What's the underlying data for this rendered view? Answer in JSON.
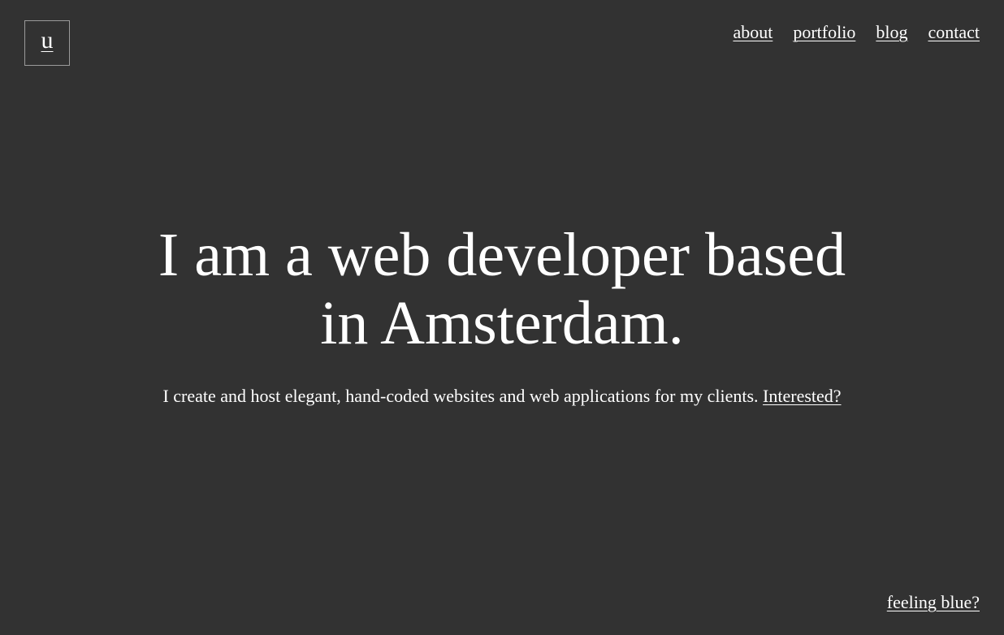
{
  "logo": {
    "letter": "u"
  },
  "nav": {
    "items": [
      {
        "label": "about"
      },
      {
        "label": "portfolio"
      },
      {
        "label": "blog"
      },
      {
        "label": "contact"
      }
    ]
  },
  "hero": {
    "heading_line1": "I am a web developer based",
    "heading_line2": "in Amsterdam.",
    "tagline": "I create and host elegant, hand-coded websites and web applications for my clients.",
    "cta_link": "Interested?"
  },
  "footer": {
    "theme_toggle": "feeling blue?"
  },
  "colors": {
    "background": "#323232",
    "text": "#ffffff",
    "logo_border": "#9a9a9a"
  }
}
